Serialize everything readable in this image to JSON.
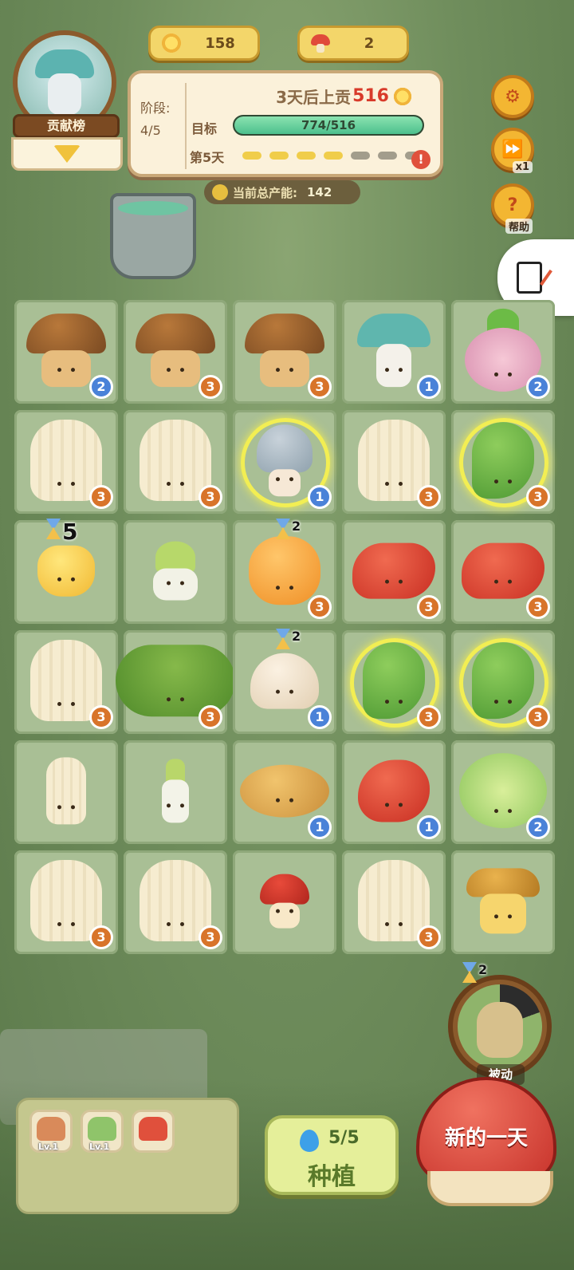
{
  "resources": {
    "sun": "158",
    "mushroom": "2"
  },
  "leaderboard": {
    "label": "贡献榜"
  },
  "goal": {
    "stage_label": "阶段:",
    "stage_value": "4/5",
    "tribute_prefix": "3天后上贡",
    "tribute_amount": "516",
    "target_label": "目标",
    "target_text": "774/516",
    "target_progress": 1.0,
    "day_label": "第5天",
    "day_dots_filled": 4,
    "day_dots_total": 7,
    "alert_glyph": "!"
  },
  "output": {
    "label": "当前总产能:",
    "value": "142"
  },
  "side": {
    "speed_caption": "x1",
    "help_caption": "帮助"
  },
  "grid": [
    [
      {
        "kind": "p-brown",
        "lvl": "2"
      },
      {
        "kind": "p-brown",
        "lvl": "3"
      },
      {
        "kind": "p-brown",
        "lvl": "3"
      },
      {
        "kind": "p-teal",
        "lvl": "1"
      },
      {
        "kind": "p-onion",
        "lvl": "2"
      }
    ],
    [
      {
        "kind": "p-enoki",
        "lvl": "3"
      },
      {
        "kind": "p-enoki",
        "lvl": "3"
      },
      {
        "kind": "p-stink",
        "lvl": "1",
        "glow": true
      },
      {
        "kind": "p-enoki",
        "lvl": "3"
      },
      {
        "kind": "p-pepper-g",
        "lvl": "3",
        "glow": true
      }
    ],
    [
      {
        "kind": "p-bell-y",
        "timer": "5"
      },
      {
        "kind": "p-bokchoy"
      },
      {
        "kind": "p-bell-o",
        "lvl": "3",
        "timer": "2"
      },
      {
        "kind": "p-pepper-r",
        "lvl": "3"
      },
      {
        "kind": "p-pepper-r",
        "lvl": "3"
      }
    ],
    [
      {
        "kind": "p-enoki",
        "lvl": "3"
      },
      {
        "kind": "p-broccoli",
        "lvl": "3"
      },
      {
        "kind": "p-button",
        "lvl": "1",
        "timer": "2"
      },
      {
        "kind": "p-pepper-g",
        "lvl": "3",
        "glow": true
      },
      {
        "kind": "p-pepper-g",
        "lvl": "3",
        "glow": true
      }
    ],
    [
      {
        "kind": "p-enoki-small"
      },
      {
        "kind": "p-leek"
      },
      {
        "kind": "p-potato",
        "lvl": "1"
      },
      {
        "kind": "p-pepper-r-small",
        "lvl": "1"
      },
      {
        "kind": "p-lettuce",
        "lvl": "2"
      }
    ],
    [
      {
        "kind": "p-enoki",
        "lvl": "3"
      },
      {
        "kind": "p-enoki",
        "lvl": "3"
      },
      {
        "kind": "p-redcap"
      },
      {
        "kind": "p-enoki",
        "lvl": "3"
      },
      {
        "kind": "p-chanterelle"
      }
    ]
  ],
  "passive": {
    "timer": "2",
    "label": "被动"
  },
  "tray": {
    "seeds": [
      {
        "level": "Lv.1",
        "color": "#d98a5a"
      },
      {
        "level": "Lv.1",
        "color": "#8fc46a"
      },
      {
        "level": "",
        "color": "#e0503c"
      }
    ]
  },
  "plant_button": {
    "energy": "5/5",
    "label": "种植"
  },
  "newday_button": {
    "label": "新的一天"
  },
  "colors": {
    "level_blue": "#4a82d8",
    "level_orange": "#d8742a",
    "glow": "#f2ee53"
  }
}
